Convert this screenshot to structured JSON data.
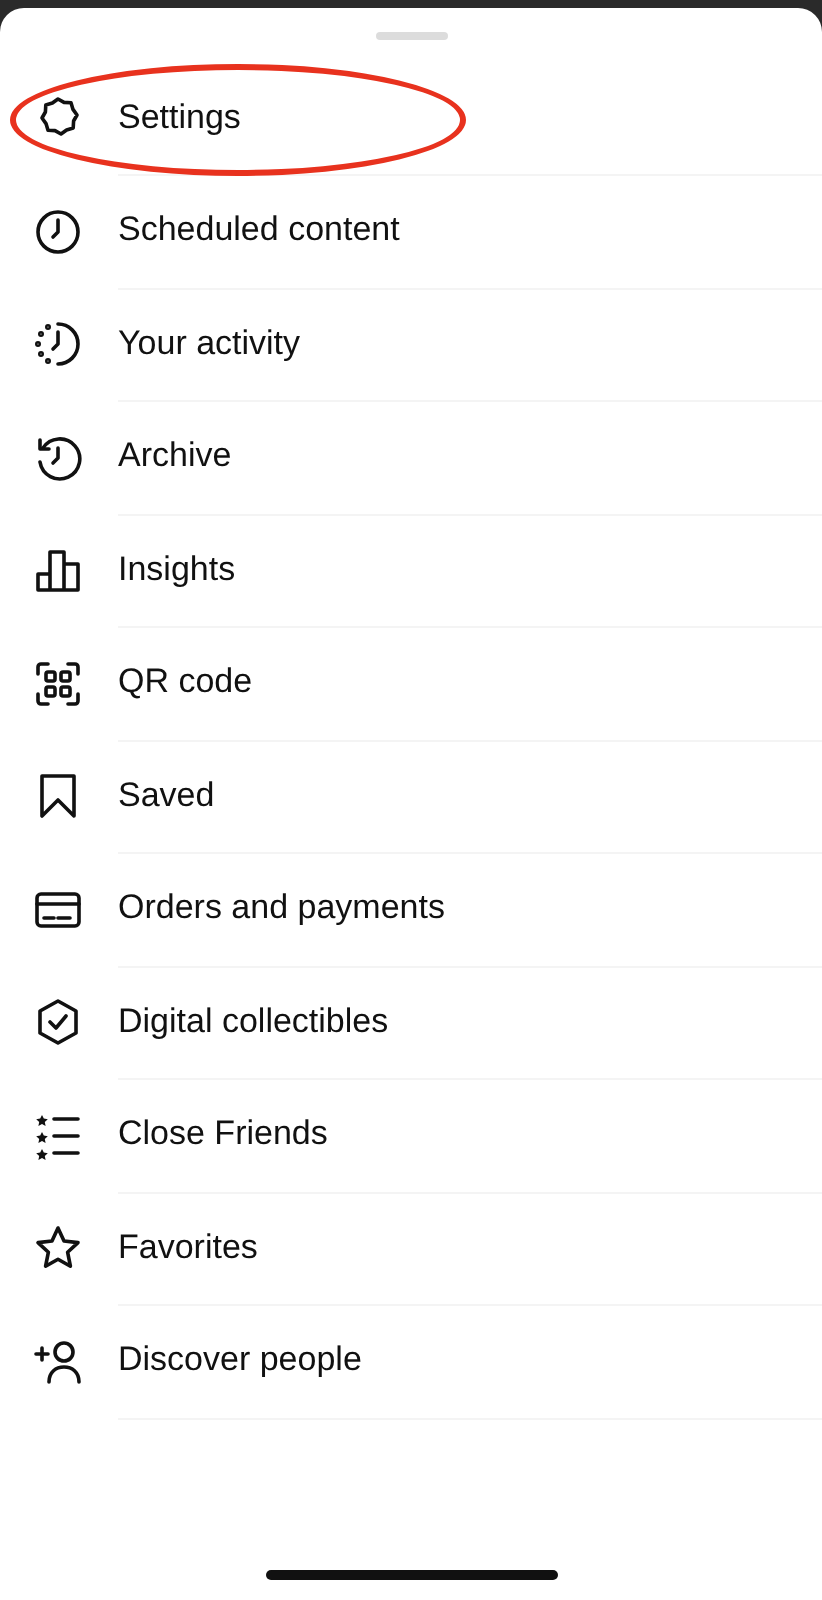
{
  "menu": {
    "items": [
      {
        "label": "Settings",
        "circled": true
      },
      {
        "label": "Scheduled content",
        "circled": false
      },
      {
        "label": "Your activity",
        "circled": false
      },
      {
        "label": "Archive",
        "circled": false
      },
      {
        "label": "Insights",
        "circled": false
      },
      {
        "label": "QR code",
        "circled": false
      },
      {
        "label": "Saved",
        "circled": false
      },
      {
        "label": "Orders and payments",
        "circled": false
      },
      {
        "label": "Digital collectibles",
        "circled": false
      },
      {
        "label": "Close Friends",
        "circled": false
      },
      {
        "label": "Favorites",
        "circled": false
      },
      {
        "label": "Discover people",
        "circled": false
      }
    ]
  }
}
